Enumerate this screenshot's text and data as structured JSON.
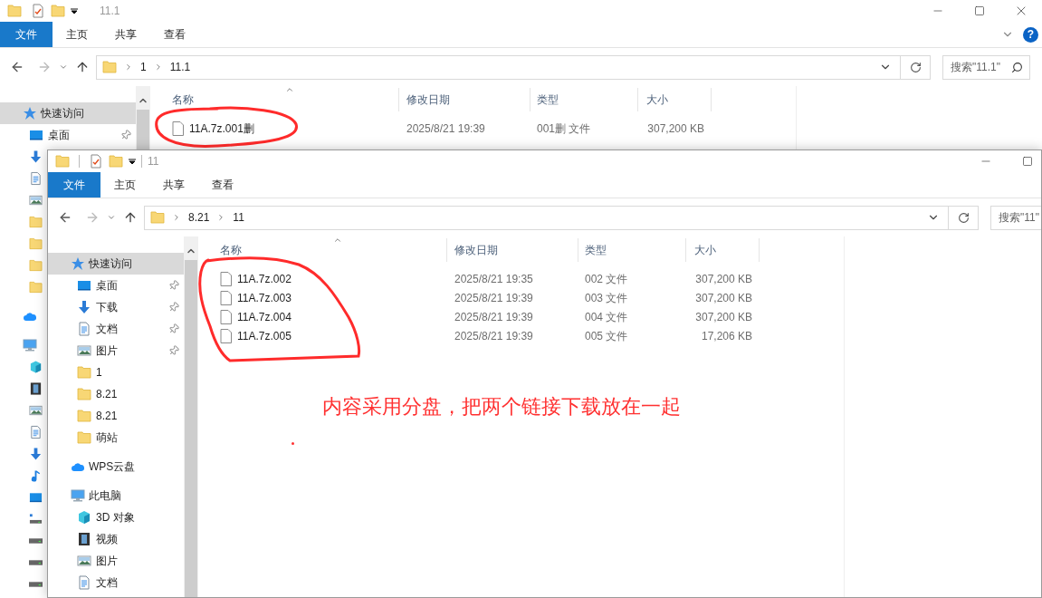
{
  "windows": [
    {
      "title": "11.1",
      "toolbar_dividers": false,
      "cut_off_right": false,
      "help": "?",
      "ribbon_tabs": [
        {
          "label": "文件",
          "selected": true
        },
        {
          "label": "主页",
          "selected": false
        },
        {
          "label": "共享",
          "selected": false
        },
        {
          "label": "查看",
          "selected": false
        }
      ],
      "breadcrumb": [
        "1",
        "11.1"
      ],
      "search": {
        "placeholder": "搜索\"11.1\""
      },
      "columns": [
        "名称",
        "修改日期",
        "类型",
        "大小"
      ],
      "files": [
        {
          "name": "11A.7z.001删",
          "modified": "2025/8/21 19:39",
          "type": "001删 文件",
          "size": "307,200 KB"
        }
      ],
      "nav": [
        {
          "label": "快速访问",
          "kind": "quick",
          "selected": true,
          "pinned": false,
          "children": [
            {
              "label": "桌面",
              "kind": "desktop",
              "selected": false,
              "pinned": true
            },
            {
              "kind": "download",
              "selected": false
            },
            {
              "kind": "document",
              "selected": false
            },
            {
              "kind": "picture",
              "selected": false
            },
            {
              "kind": "folder",
              "selected": false
            },
            {
              "kind": "folder",
              "selected": false
            },
            {
              "kind": "folder",
              "selected": false
            },
            {
              "kind": "folder",
              "selected": false
            }
          ]
        },
        {
          "kind": "cloud",
          "selected": false
        },
        {
          "kind": "pc",
          "selected": false,
          "children": [
            {
              "kind": "cube",
              "selected": false
            },
            {
              "kind": "video",
              "selected": false
            },
            {
              "kind": "picture",
              "selected": false
            },
            {
              "kind": "document",
              "selected": false
            },
            {
              "kind": "download",
              "selected": false
            },
            {
              "kind": "music",
              "selected": false
            },
            {
              "kind": "desktop",
              "selected": false
            },
            {
              "kind": "netdrive",
              "selected": false
            },
            {
              "kind": "drive",
              "selected": false
            },
            {
              "kind": "drive",
              "selected": false
            },
            {
              "kind": "drive",
              "selected": false
            }
          ]
        }
      ]
    },
    {
      "title": "11",
      "toolbar_dividers": true,
      "cut_off_right": true,
      "ribbon_tabs": [
        {
          "label": "文件",
          "selected": true
        },
        {
          "label": "主页",
          "selected": false
        },
        {
          "label": "共享",
          "selected": false
        },
        {
          "label": "查看",
          "selected": false
        }
      ],
      "breadcrumb": [
        "8.21",
        "11"
      ],
      "search": {
        "placeholder": "搜索\"11\""
      },
      "columns": [
        "名称",
        "修改日期",
        "类型",
        "大小"
      ],
      "files": [
        {
          "name": "11A.7z.002",
          "modified": "2025/8/21 19:35",
          "type": "002 文件",
          "size": "307,200 KB"
        },
        {
          "name": "11A.7z.003",
          "modified": "2025/8/21 19:39",
          "type": "003 文件",
          "size": "307,200 KB"
        },
        {
          "name": "11A.7z.004",
          "modified": "2025/8/21 19:39",
          "type": "004 文件",
          "size": "307,200 KB"
        },
        {
          "name": "11A.7z.005",
          "modified": "2025/8/21 19:39",
          "type": "005 文件",
          "size": "17,206 KB"
        }
      ],
      "nav": [
        {
          "label": "快速访问",
          "kind": "quick",
          "selected": true,
          "pinned": false,
          "children": [
            {
              "label": "桌面",
              "kind": "desktop",
              "selected": false,
              "pinned": true
            },
            {
              "label": "下载",
              "kind": "download",
              "selected": false,
              "pinned": true
            },
            {
              "label": "文档",
              "kind": "document",
              "selected": false,
              "pinned": true
            },
            {
              "label": "图片",
              "kind": "picture",
              "selected": false,
              "pinned": true
            },
            {
              "label": "1",
              "kind": "folder",
              "selected": false,
              "pinned": false
            },
            {
              "label": "8.21",
              "kind": "folder",
              "selected": false,
              "pinned": false
            },
            {
              "label": "8.21",
              "kind": "folder",
              "selected": false,
              "pinned": false
            },
            {
              "label": "萌站",
              "kind": "folder",
              "selected": false,
              "pinned": false
            }
          ]
        },
        {
          "label": "WPS云盘",
          "kind": "cloud",
          "selected": false,
          "pinned": false
        },
        {
          "label": "此电脑",
          "kind": "pc",
          "selected": false,
          "pinned": false,
          "children": [
            {
              "label": "3D 对象",
              "kind": "cube",
              "selected": false,
              "pinned": false
            },
            {
              "label": "视频",
              "kind": "video",
              "selected": false,
              "pinned": false
            },
            {
              "label": "图片",
              "kind": "picture",
              "selected": false,
              "pinned": false
            },
            {
              "label": "文档",
              "kind": "document",
              "selected": false,
              "pinned": false
            }
          ]
        }
      ]
    }
  ],
  "annotation": {
    "note": "内容采用分盘，把两个链接下载放在一起"
  }
}
